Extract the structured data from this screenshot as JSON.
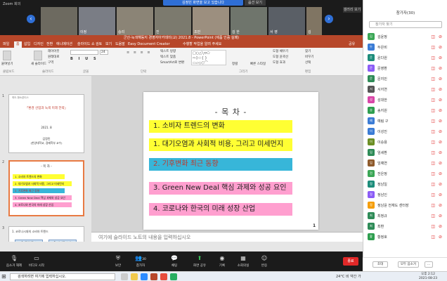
{
  "zoom_top": {
    "title": "Zoom 회의",
    "banner": "김정민 화면을 보고 있습니다",
    "view_options": "옵션 보기",
    "gallery": "갤러리 보기",
    "participants": [
      "",
      "이정",
      "승리",
      "진",
      "조민",
      "김 한",
      "서 영",
      "김"
    ]
  },
  "ppt": {
    "title_bar": "군산-녹색해동지 경영자아카데미(교) 2021.8 - PowerPoint (제품 인증 실패)",
    "menu": [
      "파일",
      "홈",
      "삽입",
      "디자인",
      "전환",
      "애니메이션",
      "슬라이드 쇼",
      "검토",
      "보기",
      "도움말",
      "Easy Document Creator"
    ],
    "tell_me": "수행할 작업을 알려 주세요",
    "share": "공유",
    "ribbon": {
      "paste": "붙여넣기",
      "new_slide": "새 슬라이드",
      "layout": "레이아웃",
      "reset": "원래대로",
      "section": "구역",
      "font_size": "24",
      "find": "찾기",
      "replace": "바꾸기",
      "select": "선택",
      "arrange": "정렬",
      "quick_styles": "빠른 스타일",
      "shape_fill": "도형 채우기",
      "shape_outline": "도형 윤곽선",
      "shape_effects": "도형 효과",
      "text_direction": "텍스트 방향",
      "text_align": "텍스트 맞춤",
      "smartart": "SmartArt로 변환",
      "groups": [
        "클립보드",
        "슬라이드",
        "글꼴",
        "단락",
        "그리기",
        "편집"
      ]
    },
    "thumbnails": {
      "slide1": {
        "num": "1",
        "top_text": "최도-형소폰티스",
        "title": "「환경 산업과 녹색 미래 전략」",
        "date": "2021. 8",
        "author": "김정민",
        "author_sub": "(한양대학교, 경제학부 교수)"
      },
      "slide2": {
        "num": "2",
        "title": "- 목 차 -",
        "items": [
          "1. 소비자 트렌드의 변화",
          "2. 대기오염과 사회적 비용, 그리고 미세먼지",
          "2. 기후변화 최근 동향",
          "3. Green New Deal 핵심 과제와 성공 요인",
          "4. 코로나와 한국의 미래 성장 산업"
        ]
      },
      "slide3": {
        "num": "3",
        "title": "1. 코로나시대의 소비자 트렌드",
        "box1": "1. 절약 중시",
        "box2": "2. 신뢰도 소비"
      }
    },
    "slide": {
      "title": "- 목 차 -",
      "items": [
        "1. 소비자 트렌드의 변화",
        "1. 대기오염과 사회적 비용, 그리고 미세먼지",
        "2. 기후변화 최근 동향",
        "3. Green New Deal 핵심 과제와 성공 요인",
        "4. 코로나와 한국의 미래 성장 산업"
      ],
      "colors": [
        "#ffff33",
        "#ffff33",
        "#37b6d9",
        "#ff9fcf",
        "#ff9fcf"
      ],
      "page": "1"
    },
    "notes_placeholder": "여기에 슬라이드 노트의 내용을 입력하십시오"
  },
  "zoom_bottom": {
    "items": [
      "음소거 해제",
      "비디오 시작",
      "보안",
      "참가자",
      "채팅",
      "화면 공유",
      "기록",
      "소회의실",
      "반응"
    ],
    "icons": [
      "mic-off-icon",
      "video-off-icon",
      "shield-icon",
      "people-icon",
      "chat-icon",
      "share-screen-icon",
      "record-icon",
      "breakout-icon",
      "reaction-icon"
    ],
    "participant_count": "30",
    "end": "종료"
  },
  "panel": {
    "title": "참가자(30)",
    "search_placeholder": "참가자 찾기",
    "participants": [
      {
        "name": "김윤정",
        "color": "#3aa655"
      },
      {
        "name": "두은비",
        "color": "#3a7bd5"
      },
      {
        "name": "윤다원",
        "color": "#1c8c7a"
      },
      {
        "name": "문영환",
        "color": "#8b5cf6"
      },
      {
        "name": "문지민",
        "color": "#2e8b57"
      },
      {
        "name": "서지연",
        "color": "#555555"
      },
      {
        "name": "성대한",
        "color": "#d946a8"
      },
      {
        "name": "송지원",
        "color": "#2e9e4f"
      },
      {
        "name": "예림 구",
        "color": "#3a7bd5"
      },
      {
        "name": "이성진",
        "color": "#3a7bd5"
      },
      {
        "name": "이승용",
        "color": "#6b8e23"
      },
      {
        "name": "임세환",
        "color": "#2e8b57"
      },
      {
        "name": "임예연",
        "color": "#8e5a2b"
      },
      {
        "name": "전은정",
        "color": "#3aa655"
      },
      {
        "name": "정남일",
        "color": "#1c8c7a"
      },
      {
        "name": "정남인",
        "color": "#8b5cf6"
      },
      {
        "name": "정남윤 전재도 센터장",
        "color": "#f59e0b"
      },
      {
        "name": "최정규",
        "color": "#2e8b57"
      },
      {
        "name": "최환",
        "color": "#2e8b57"
      },
      {
        "name": "황정호",
        "color": "#2e9e4f"
      }
    ],
    "invite": "초대",
    "mute_all": "모두 음소거",
    "more": "..."
  },
  "taskbar": {
    "search": "검색하려면 여기에 입력하십시오.",
    "weather": "24°C 비 약간",
    "lang": "가",
    "time": "오후 2:12",
    "date": "2021-08-23"
  }
}
